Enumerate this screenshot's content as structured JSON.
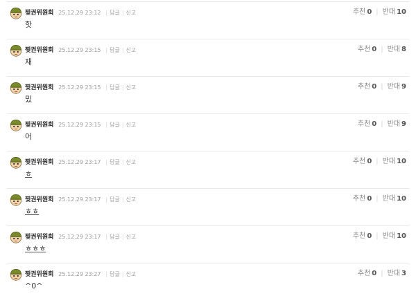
{
  "vote_labels": {
    "up": "추천",
    "down": "반대"
  },
  "action_labels": {
    "reply": "답글",
    "report": "신고"
  },
  "comments": [
    {
      "author": "찢권위원회",
      "date": "25.12.29 23:12",
      "text": "핫",
      "up": "0",
      "down": "10",
      "underline": false
    },
    {
      "author": "찢권위원회",
      "date": "25.12.29 23:15",
      "text": "재",
      "up": "0",
      "down": "8",
      "underline": false
    },
    {
      "author": "찢권위원회",
      "date": "25.12.29 23:15",
      "text": "밌",
      "up": "0",
      "down": "9",
      "underline": false
    },
    {
      "author": "찢권위원회",
      "date": "25.12.29 23:15",
      "text": "어",
      "up": "0",
      "down": "9",
      "underline": false
    },
    {
      "author": "찢권위원회",
      "date": "25.12.29 23:17",
      "text": "ㅎ",
      "up": "0",
      "down": "10",
      "underline": true
    },
    {
      "author": "찢권위원회",
      "date": "25.12.29 23:17",
      "text": "ㅎㅎ",
      "up": "0",
      "down": "10",
      "underline": true
    },
    {
      "author": "찢권위원회",
      "date": "25.12.29 23:17",
      "text": "ㅎㅎㅎ",
      "up": "0",
      "down": "10",
      "underline": true
    },
    {
      "author": "찢권위원회",
      "date": "25.12.29 23:27",
      "text": "^0^",
      "up": "0",
      "down": "3",
      "underline": false
    }
  ]
}
